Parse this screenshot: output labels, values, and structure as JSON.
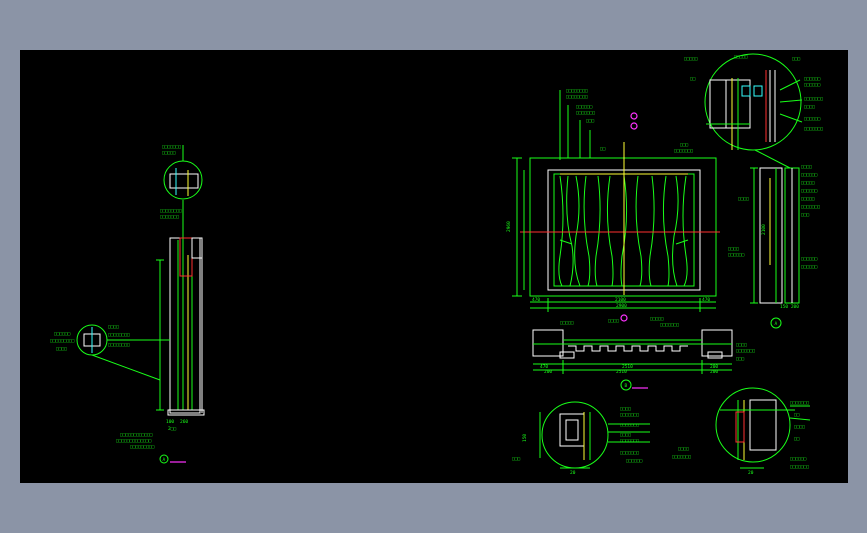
{
  "drawing": {
    "left_section_label": "A",
    "elevation_label": "A",
    "plan_label": "B",
    "dim_width_total": "2900",
    "dim_width_inner": "2100",
    "dim_side_left": "470",
    "dim_side_right": "470",
    "dim_height_total": "2960",
    "dim_plan_total": "2510",
    "dim_plan_left": "470",
    "dim_plan_right": "200",
    "dim_detail_1": "150",
    "dim_detail_2": "20"
  },
  "colors": {
    "background": "#8b94a6",
    "canvas": "#000000",
    "line_primary": "#19ff19",
    "line_secondary": "#ffffff",
    "accent_yellow": "#ffff33",
    "accent_red": "#ff3030",
    "accent_magenta": "#ff33ff",
    "accent_cyan": "#33ffff"
  }
}
